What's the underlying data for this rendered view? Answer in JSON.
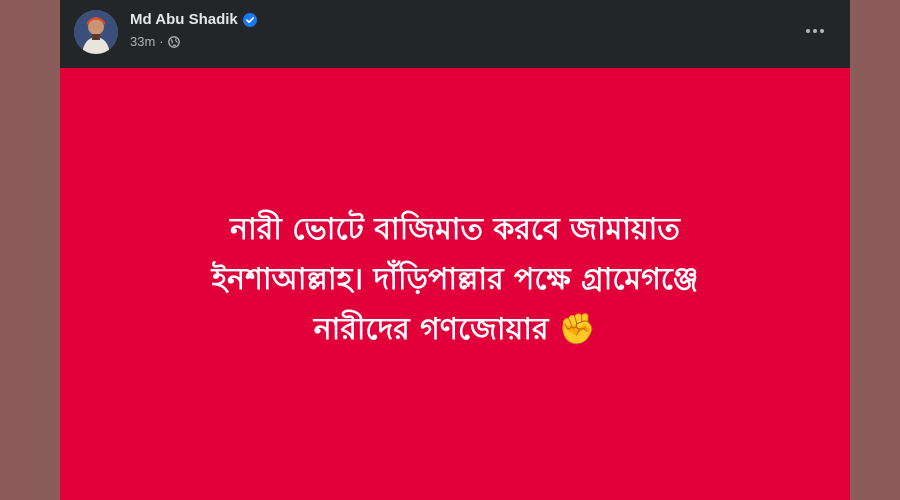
{
  "post": {
    "author": {
      "name": "Md Abu Shadik",
      "verified": true,
      "avatar_icon": "profile-avatar"
    },
    "meta": {
      "time": "33m",
      "separator": "·",
      "audience_icon": "globe-icon"
    },
    "more_icon": "more-horizontal-icon",
    "content": {
      "background_color": "#e2003a",
      "text_color": "#ffffff",
      "lines": [
        "নারী ভোটে বাজিমাত করবে জামায়াত",
        "ইনশাআল্লাহ। দাঁড়িপাল্লার পক্ষে গ্রামেগঞ্জে",
        "নারীদের গণজোয়ার ✊"
      ]
    }
  },
  "colors": {
    "card_header": "#242526",
    "name_text": "#e4e6eb",
    "meta_text": "#b0b3b8",
    "verified_badge": "#1877f2",
    "page_background": "#8b5b5b"
  }
}
